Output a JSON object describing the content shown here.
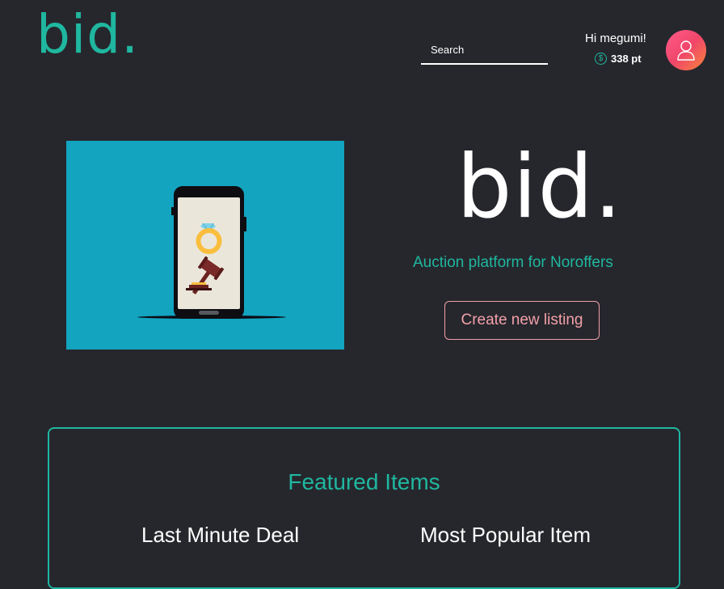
{
  "header": {
    "logo_text": "bid.",
    "search": {
      "placeholder": "Search",
      "value": ""
    },
    "user": {
      "greeting": "Hi megumi!",
      "points": "338 pt",
      "coin_symbol": "$"
    }
  },
  "hero": {
    "title": "bid.",
    "tagline": "Auction platform for Noroffers",
    "cta_label": "Create new listing"
  },
  "featured": {
    "title": "Featured Items",
    "columns": [
      "Last Minute Deal",
      "Most Popular Item"
    ]
  },
  "colors": {
    "background": "#26272d",
    "accent": "#1fb79f",
    "cta": "#f2a0a8",
    "hero_image_bg": "#13a4c0"
  }
}
